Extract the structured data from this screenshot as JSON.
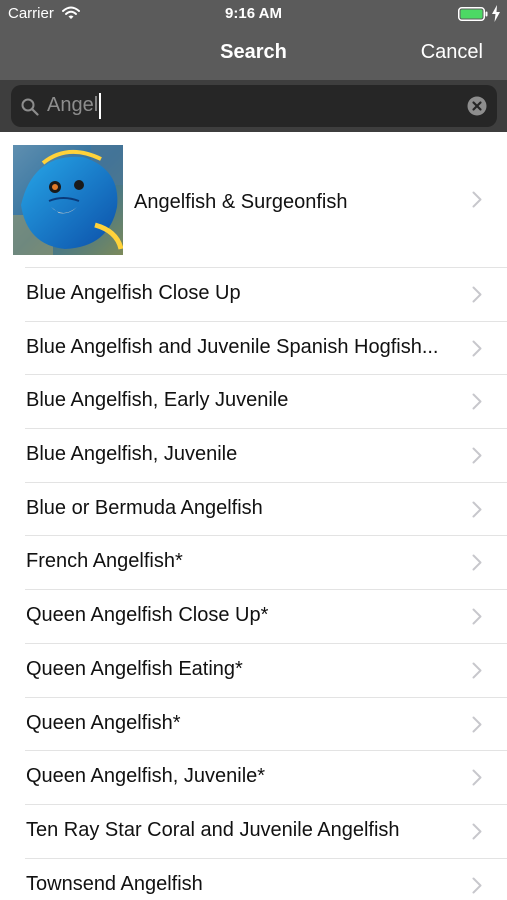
{
  "status_bar": {
    "carrier": "Carrier",
    "time": "9:16 AM",
    "battery_color": "#4cd964"
  },
  "nav": {
    "title": "Search",
    "cancel_label": "Cancel"
  },
  "search": {
    "query": "Angel"
  },
  "category": {
    "label": "Angelfish & Surgeonfish"
  },
  "results": [
    {
      "label": "Blue Angelfish Close Up"
    },
    {
      "label": "Blue Angelfish and Juvenile Spanish Hogfish..."
    },
    {
      "label": "Blue Angelfish, Early Juvenile"
    },
    {
      "label": "Blue Angelfish, Juvenile"
    },
    {
      "label": "Blue or Bermuda Angelfish"
    },
    {
      "label": "French Angelfish*"
    },
    {
      "label": "Queen Angelfish Close Up*"
    },
    {
      "label": "Queen Angelfish Eating*"
    },
    {
      "label": "Queen Angelfish*"
    },
    {
      "label": "Queen Angelfish, Juvenile*"
    },
    {
      "label": "Ten Ray Star Coral and Juvenile Angelfish"
    },
    {
      "label": "Townsend Angelfish"
    }
  ]
}
